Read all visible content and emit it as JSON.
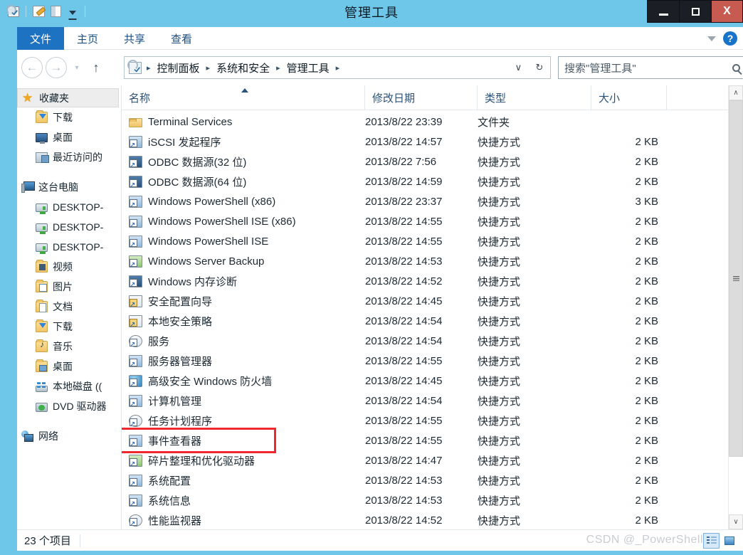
{
  "window": {
    "title": "管理工具",
    "quick_access": [
      {
        "name": "properties-icon",
        "label": "属性"
      },
      {
        "name": "new-folder-icon",
        "label": "新建文件夹"
      },
      {
        "name": "rename-icon",
        "label": "重命名"
      },
      {
        "name": "customize-caret-icon",
        "label": "自定义快速访问工具栏"
      }
    ],
    "controls": {
      "minimize": "–",
      "maximize": "□",
      "close": "X"
    }
  },
  "ribbon": {
    "tabs": [
      {
        "label": "文件",
        "active": true
      },
      {
        "label": "主页",
        "active": false
      },
      {
        "label": "共享",
        "active": false
      },
      {
        "label": "查看",
        "active": false
      }
    ],
    "collapse_icon": "chevron-down-icon",
    "help_label": "?"
  },
  "addressbar": {
    "back_glyph": "←",
    "forward_glyph": "→",
    "recent_glyph": "▾",
    "up_glyph": "↑",
    "breadcrumbs": [
      "控制面板",
      "系统和安全",
      "管理工具"
    ],
    "separator": "▸",
    "history_glyph": "∨",
    "refresh_glyph": "↻",
    "search": {
      "placeholder": "搜索\"管理工具\"",
      "value": "搜索\"管理工具\""
    }
  },
  "sidebar": {
    "groups": [
      {
        "header": {
          "label": "收藏夹",
          "icon": "star-icon",
          "selected": true
        },
        "items": [
          {
            "label": "下载",
            "icon": "folder-download-icon"
          },
          {
            "label": "桌面",
            "icon": "desktop-monitor-icon"
          },
          {
            "label": "最近访问的",
            "icon": "recent-places-icon"
          }
        ]
      },
      {
        "header": {
          "label": "这台电脑",
          "icon": "this-pc-icon",
          "selected": false
        },
        "items": [
          {
            "label": "DESKTOP-",
            "icon": "server-share-icon"
          },
          {
            "label": "DESKTOP-",
            "icon": "server-share-icon"
          },
          {
            "label": "DESKTOP-",
            "icon": "server-share-icon"
          },
          {
            "label": "视频",
            "icon": "folder-videos-icon"
          },
          {
            "label": "图片",
            "icon": "folder-pictures-icon"
          },
          {
            "label": "文档",
            "icon": "folder-documents-icon"
          },
          {
            "label": "下载",
            "icon": "folder-download-icon"
          },
          {
            "label": "音乐",
            "icon": "folder-music-icon"
          },
          {
            "label": "桌面",
            "icon": "folder-desktop-icon"
          },
          {
            "label": "本地磁盘 ((",
            "icon": "local-disk-icon"
          },
          {
            "label": "DVD 驱动器",
            "icon": "dvd-drive-icon"
          }
        ]
      },
      {
        "header": {
          "label": "网络",
          "icon": "network-icon",
          "selected": false
        },
        "items": []
      }
    ]
  },
  "filelist": {
    "columns": [
      {
        "label": "名称",
        "sorted": true,
        "sort_dir": "asc"
      },
      {
        "label": "修改日期",
        "sorted": false
      },
      {
        "label": "类型",
        "sorted": false
      },
      {
        "label": "大小",
        "sorted": false
      }
    ],
    "rows": [
      {
        "name": "Terminal Services",
        "date": "2013/8/22 23:39",
        "type": "文件夹",
        "size": "",
        "icon": "folder-icon"
      },
      {
        "name": "iSCSI 发起程序",
        "date": "2013/8/22 14:57",
        "type": "快捷方式",
        "size": "2 KB",
        "icon": "shortcut-icon"
      },
      {
        "name": "ODBC 数据源(32 位)",
        "date": "2013/8/22 7:56",
        "type": "快捷方式",
        "size": "2 KB",
        "icon": "shortcut-icon"
      },
      {
        "name": "ODBC 数据源(64 位)",
        "date": "2013/8/22 14:59",
        "type": "快捷方式",
        "size": "2 KB",
        "icon": "shortcut-icon"
      },
      {
        "name": "Windows PowerShell (x86)",
        "date": "2013/8/22 23:37",
        "type": "快捷方式",
        "size": "3 KB",
        "icon": "shortcut-icon"
      },
      {
        "name": "Windows PowerShell ISE (x86)",
        "date": "2013/8/22 14:55",
        "type": "快捷方式",
        "size": "2 KB",
        "icon": "shortcut-icon"
      },
      {
        "name": "Windows PowerShell ISE",
        "date": "2013/8/22 14:55",
        "type": "快捷方式",
        "size": "2 KB",
        "icon": "shortcut-icon"
      },
      {
        "name": "Windows Server Backup",
        "date": "2013/8/22 14:53",
        "type": "快捷方式",
        "size": "2 KB",
        "icon": "shortcut-green-icon"
      },
      {
        "name": "Windows 内存诊断",
        "date": "2013/8/22 14:52",
        "type": "快捷方式",
        "size": "2 KB",
        "icon": "shortcut-icon"
      },
      {
        "name": "安全配置向导",
        "date": "2013/8/22 14:45",
        "type": "快捷方式",
        "size": "2 KB",
        "icon": "shortcut-lock-icon"
      },
      {
        "name": "本地安全策略",
        "date": "2013/8/22 14:54",
        "type": "快捷方式",
        "size": "2 KB",
        "icon": "shortcut-lock-icon"
      },
      {
        "name": "服务",
        "date": "2013/8/22 14:54",
        "type": "快捷方式",
        "size": "2 KB",
        "icon": "shortcut-gear-icon"
      },
      {
        "name": "服务器管理器",
        "date": "2013/8/22 14:55",
        "type": "快捷方式",
        "size": "2 KB",
        "icon": "shortcut-icon"
      },
      {
        "name": "高级安全 Windows 防火墙",
        "date": "2013/8/22 14:45",
        "type": "快捷方式",
        "size": "2 KB",
        "icon": "shortcut-globe-icon"
      },
      {
        "name": "计算机管理",
        "date": "2013/8/22 14:54",
        "type": "快捷方式",
        "size": "2 KB",
        "icon": "shortcut-icon"
      },
      {
        "name": "任务计划程序",
        "date": "2013/8/22 14:55",
        "type": "快捷方式",
        "size": "2 KB",
        "icon": "shortcut-round-icon"
      },
      {
        "name": "事件查看器",
        "date": "2013/8/22 14:55",
        "type": "快捷方式",
        "size": "2 KB",
        "icon": "shortcut-icon",
        "highlighted": true
      },
      {
        "name": "碎片整理和优化驱动器",
        "date": "2013/8/22 14:47",
        "type": "快捷方式",
        "size": "2 KB",
        "icon": "shortcut-green-icon"
      },
      {
        "name": "系统配置",
        "date": "2013/8/22 14:53",
        "type": "快捷方式",
        "size": "2 KB",
        "icon": "shortcut-blue-icon"
      },
      {
        "name": "系统信息",
        "date": "2013/8/22 14:53",
        "type": "快捷方式",
        "size": "2 KB",
        "icon": "shortcut-blue-icon"
      },
      {
        "name": "性能监视器",
        "date": "2013/8/22 14:52",
        "type": "快捷方式",
        "size": "2 KB",
        "icon": "shortcut-round-icon"
      }
    ],
    "scrollbar": {
      "up_glyph": "∧",
      "down_glyph": "∨"
    },
    "highlight_color": "#f0282d"
  },
  "statusbar": {
    "item_count": "23 个项目",
    "views": [
      {
        "name": "details-view-button",
        "active": true
      },
      {
        "name": "large-icons-view-button",
        "active": false
      }
    ]
  },
  "watermark": {
    "text": "CSDN @_PowerShell"
  },
  "colors": {
    "titlebar": "#6ec6e8",
    "accent": "#1e72c2",
    "close_button": "#c75b52",
    "highlight": "#f0282d"
  }
}
